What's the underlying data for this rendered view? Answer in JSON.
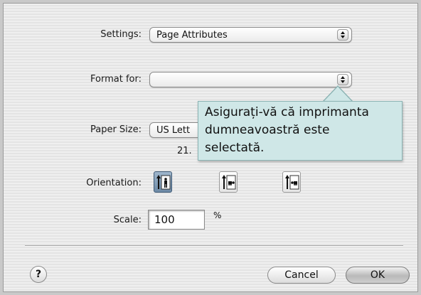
{
  "settings": {
    "label": "Settings:",
    "value": "Page Attributes"
  },
  "format_for": {
    "label": "Format for:",
    "value": ""
  },
  "paper_size": {
    "label": "Paper Size:",
    "value": "US Lett",
    "dimensions": "21."
  },
  "orientation": {
    "label": "Orientation:",
    "options": [
      "portrait-icon",
      "landscape-icon",
      "reverse-landscape-icon"
    ],
    "selected_index": 0
  },
  "scale": {
    "label": "Scale:",
    "value": "100",
    "unit": "%"
  },
  "buttons": {
    "help": "?",
    "cancel": "Cancel",
    "ok": "OK"
  },
  "callout": {
    "lines": [
      "Asigurați-vă că imprimanta",
      "dumneavoastră este",
      "selectată."
    ]
  }
}
